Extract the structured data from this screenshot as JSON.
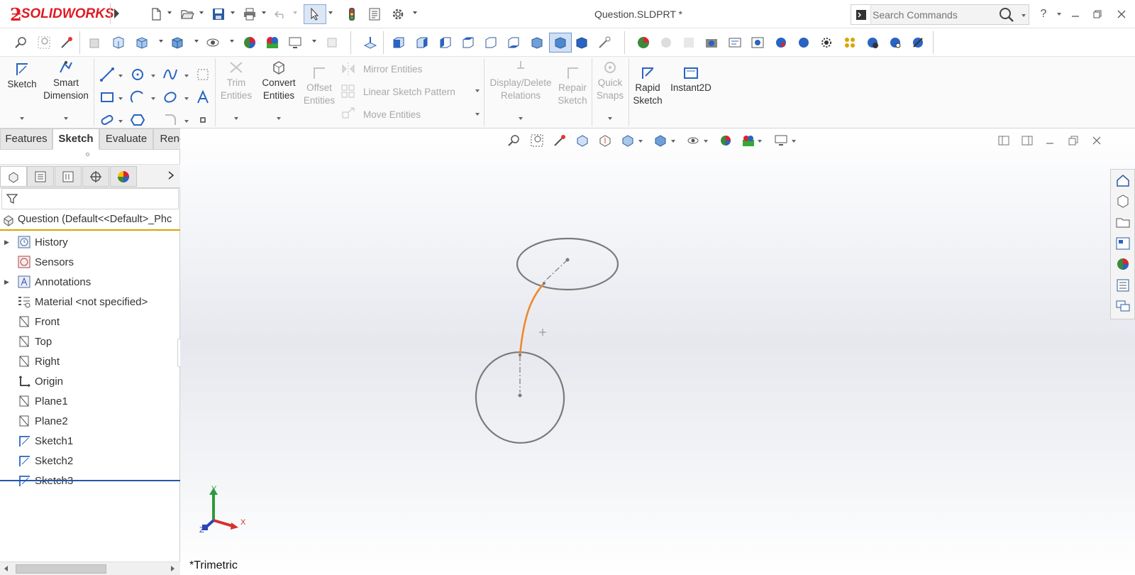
{
  "app": {
    "brand": "SOLIDWORKS",
    "document_title": "Question.SLDPRT *",
    "search_placeholder": "Search Commands",
    "help_label": "?"
  },
  "ribbon": {
    "sketch": "Sketch",
    "smart_dimension": [
      "Smart",
      "Dimension"
    ],
    "trim_entities": [
      "Trim",
      "Entities"
    ],
    "convert_entities": [
      "Convert",
      "Entities"
    ],
    "offset_entities": [
      "Offset",
      "Entities"
    ],
    "mirror_entities": "Mirror Entities",
    "linear_sketch_pattern": "Linear Sketch Pattern",
    "move_entities": "Move Entities",
    "display_delete_relations": [
      "Display/Delete",
      "Relations"
    ],
    "repair_sketch": [
      "Repair",
      "Sketch"
    ],
    "quick_snaps": [
      "Quick",
      "Snaps"
    ],
    "rapid_sketch": [
      "Rapid",
      "Sketch"
    ],
    "instant2d": "Instant2D"
  },
  "tabs": [
    "Features",
    "Sketch",
    "Evaluate",
    "Render Tools"
  ],
  "active_tab": "Sketch",
  "feature_tree": {
    "root": "Question  (Default<<Default>_Phc",
    "items": [
      {
        "label": "History",
        "icon": "history-icon",
        "expandable": true
      },
      {
        "label": "Sensors",
        "icon": "sensors-icon",
        "expandable": false
      },
      {
        "label": "Annotations",
        "icon": "annotations-icon",
        "expandable": true
      },
      {
        "label": "Material <not specified>",
        "icon": "material-icon",
        "expandable": false
      },
      {
        "label": "Front",
        "icon": "plane-icon",
        "expandable": false
      },
      {
        "label": "Top",
        "icon": "plane-icon",
        "expandable": false
      },
      {
        "label": "Right",
        "icon": "plane-icon",
        "expandable": false
      },
      {
        "label": "Origin",
        "icon": "origin-icon",
        "expandable": false
      },
      {
        "label": "Plane1",
        "icon": "plane-icon",
        "expandable": false
      },
      {
        "label": "Plane2",
        "icon": "plane-icon",
        "expandable": false
      },
      {
        "label": "Sketch1",
        "icon": "sketch-icon",
        "expandable": false
      },
      {
        "label": "Sketch2",
        "icon": "sketch-icon",
        "expandable": false
      },
      {
        "label": "Sketch3",
        "icon": "sketch-icon",
        "expandable": false
      }
    ]
  },
  "viewport": {
    "view_orientation": "*Trimetric",
    "triad": {
      "x": "X",
      "y": "Y",
      "z": "Z"
    },
    "selected_curve_color": "#f0882a",
    "sketch_color": "#7a7a7a"
  },
  "colors": {
    "brand_red": "#e01b22",
    "active_tab": "#ffffff",
    "root_underline": "#d8a400"
  }
}
